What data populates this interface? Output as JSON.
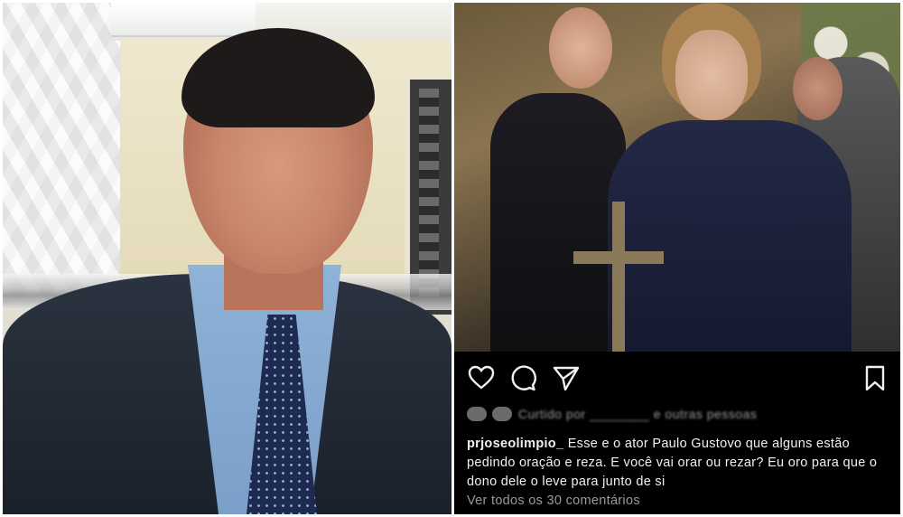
{
  "post": {
    "username": "prjoseolimpio_",
    "caption": "Esse e o ator Paulo Gustovo que alguns estão pedindo oração e reza. E você vai orar ou rezar? Eu oro para que o dono dele o leve para junto de si",
    "likes_text": "Curtido por ________ e outras pessoas",
    "view_comments": "Ver todos os 30 comentários"
  },
  "icons": {
    "like": "heart-icon",
    "comment": "comment-icon",
    "share": "send-icon",
    "save": "bookmark-icon"
  },
  "colors": {
    "ig_background": "#000000",
    "text_primary": "#f0f0f0",
    "text_muted": "#9a9a9a"
  }
}
